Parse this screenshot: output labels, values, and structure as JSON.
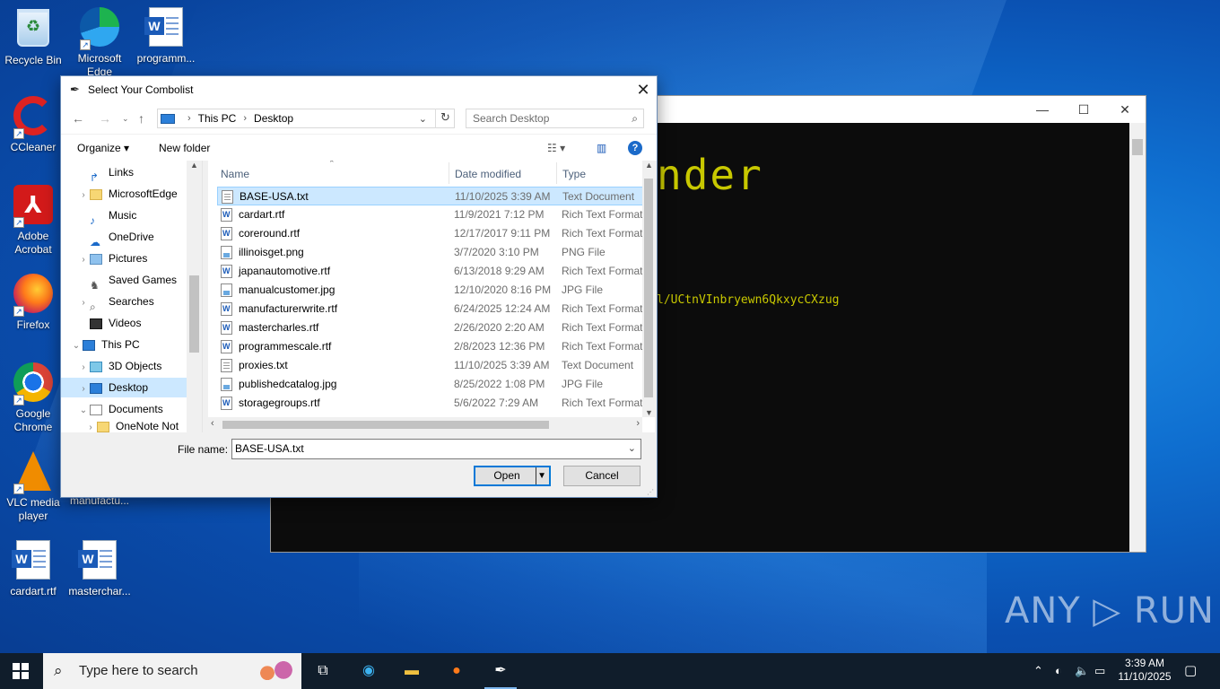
{
  "desktop": {
    "icons": [
      {
        "label": "Recycle Bin"
      },
      {
        "label": "Microsoft Edge"
      },
      {
        "label": "programm..."
      },
      {
        "label": "CCleaner"
      },
      {
        "label": "Adobe Acrobat"
      },
      {
        "label": "Firefox"
      },
      {
        "label": "Google Chrome"
      },
      {
        "label": "VLC media player"
      },
      {
        "label": "manufactu..."
      },
      {
        "label": "cardart.rtf"
      },
      {
        "label": "masterchar..."
      }
    ],
    "watermark": "ANY ▷ RUN"
  },
  "console": {
    "ascii_fragment": "nder",
    "line": "l/UCtnVInbryewn6QkxycCXzug",
    "controls": {
      "minimize": "—",
      "maximize": "☐",
      "close": "✕"
    }
  },
  "dialog": {
    "title": "Select Your Combolist",
    "close": "✕",
    "address": {
      "segments": [
        "This PC",
        "Desktop"
      ]
    },
    "search_placeholder": "Search Desktop",
    "toolbar": {
      "organize": "Organize ▾",
      "new_folder": "New folder",
      "help": "?"
    },
    "nav_items": [
      {
        "label": "Links",
        "expandable": false
      },
      {
        "label": "MicrosoftEdge",
        "expandable": true
      },
      {
        "label": "Music",
        "expandable": false
      },
      {
        "label": "OneDrive",
        "expandable": false
      },
      {
        "label": "Pictures",
        "expandable": true
      },
      {
        "label": "Saved Games",
        "expandable": false
      },
      {
        "label": "Searches",
        "expandable": true
      },
      {
        "label": "Videos",
        "expandable": false
      },
      {
        "label": "This PC",
        "expandable": true
      },
      {
        "label": "3D Objects",
        "expandable": true
      },
      {
        "label": "Desktop",
        "expandable": true,
        "selected": true
      },
      {
        "label": "Documents",
        "expandable": true
      },
      {
        "label": "OneNote Not",
        "expandable": true
      }
    ],
    "columns": {
      "name": "Name",
      "date": "Date modified",
      "type": "Type"
    },
    "files": [
      {
        "name": "BASE-USA.txt",
        "date": "11/10/2025 3:39 AM",
        "type": "Text Document",
        "icon": "txt",
        "selected": true
      },
      {
        "name": "cardart.rtf",
        "date": "11/9/2021 7:12 PM",
        "type": "Rich Text Format",
        "icon": "rtf"
      },
      {
        "name": "coreround.rtf",
        "date": "12/17/2017 9:11 PM",
        "type": "Rich Text Format",
        "icon": "rtf"
      },
      {
        "name": "illinoisget.png",
        "date": "3/7/2020 3:10 PM",
        "type": "PNG File",
        "icon": "img"
      },
      {
        "name": "japanautomotive.rtf",
        "date": "6/13/2018 9:29 AM",
        "type": "Rich Text Format",
        "icon": "rtf"
      },
      {
        "name": "manualcustomer.jpg",
        "date": "12/10/2020 8:16 PM",
        "type": "JPG File",
        "icon": "img"
      },
      {
        "name": "manufacturerwrite.rtf",
        "date": "6/24/2025 12:24 AM",
        "type": "Rich Text Format",
        "icon": "rtf"
      },
      {
        "name": "mastercharles.rtf",
        "date": "2/26/2020 2:20 AM",
        "type": "Rich Text Format",
        "icon": "rtf"
      },
      {
        "name": "programmescale.rtf",
        "date": "2/8/2023 12:36 PM",
        "type": "Rich Text Format",
        "icon": "rtf"
      },
      {
        "name": "proxies.txt",
        "date": "11/10/2025 3:39 AM",
        "type": "Text Document",
        "icon": "txt"
      },
      {
        "name": "publishedcatalog.jpg",
        "date": "8/25/2022 1:08 PM",
        "type": "JPG File",
        "icon": "img"
      },
      {
        "name": "storagegroups.rtf",
        "date": "5/6/2022 7:29 AM",
        "type": "Rich Text Format",
        "icon": "rtf"
      }
    ],
    "filename_label": "File name:",
    "filename_value": "BASE-USA.txt",
    "open_label": "Open",
    "cancel_label": "Cancel"
  },
  "taskbar": {
    "search_placeholder": "Type here to search",
    "time": "3:39 AM",
    "date": "11/10/2025"
  }
}
